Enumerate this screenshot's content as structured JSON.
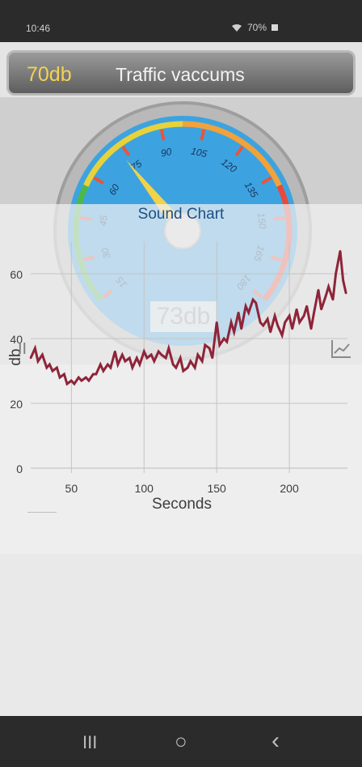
{
  "status": {
    "time": "10:46",
    "battery": "70%"
  },
  "header": {
    "db_value": "70db",
    "label": "Traffic vaccums"
  },
  "gauge": {
    "reading": "73db",
    "ticks": [
      "15",
      "30",
      "45",
      "60",
      "75",
      "90",
      "105",
      "120",
      "135",
      "150",
      "165",
      "180"
    ],
    "arc_colors": [
      "#4db84a",
      "#e8d23a",
      "#f2a23a",
      "#e84a3a"
    ],
    "face_color": "#3da3e0"
  },
  "chart_data": {
    "type": "line",
    "title": "Sound Chart",
    "xlabel": "Seconds",
    "ylabel": "db",
    "xlim": [
      22,
      240
    ],
    "ylim": [
      0,
      70
    ],
    "xticks": [
      50,
      100,
      150,
      200
    ],
    "yticks": [
      0,
      20,
      40,
      60
    ],
    "grid": true,
    "color": "#8e2438",
    "x": [
      22,
      25,
      27,
      30,
      33,
      35,
      37,
      40,
      42,
      45,
      47,
      50,
      52,
      55,
      57,
      60,
      62,
      65,
      67,
      70,
      72,
      75,
      77,
      80,
      82,
      85,
      87,
      90,
      92,
      95,
      97,
      100,
      102,
      105,
      107,
      110,
      112,
      115,
      117,
      120,
      122,
      125,
      127,
      130,
      132,
      135,
      137,
      140,
      142,
      145,
      147,
      150,
      152,
      155,
      157,
      160,
      162,
      165,
      167,
      170,
      172,
      175,
      177,
      180,
      182,
      185,
      187,
      190,
      192,
      195,
      197,
      200,
      202,
      205,
      207,
      210,
      212,
      215,
      217,
      220,
      222,
      225,
      227,
      230,
      232,
      235,
      237,
      239
    ],
    "y": [
      34,
      37,
      33,
      35,
      31,
      32,
      30,
      31,
      28,
      29,
      26,
      27,
      26,
      28,
      27,
      28,
      27,
      29,
      29,
      32,
      30,
      32,
      31,
      36,
      32,
      35,
      33,
      34,
      31,
      34,
      32,
      36,
      34,
      35,
      33,
      36,
      35,
      34,
      37,
      32,
      31,
      34,
      30,
      31,
      33,
      31,
      35,
      33,
      38,
      37,
      34,
      45,
      38,
      40,
      39,
      45,
      42,
      48,
      43,
      50,
      48,
      52,
      51,
      45,
      44,
      46,
      42,
      47,
      44,
      41,
      45,
      47,
      43,
      49,
      45,
      47,
      50,
      43,
      48,
      55,
      49,
      53,
      56,
      52,
      60,
      67,
      58,
      54
    ]
  },
  "side": {
    "pause": "II",
    "chart": "chart-icon"
  },
  "nav": {
    "recents": "III",
    "home": "○",
    "back": "‹"
  }
}
